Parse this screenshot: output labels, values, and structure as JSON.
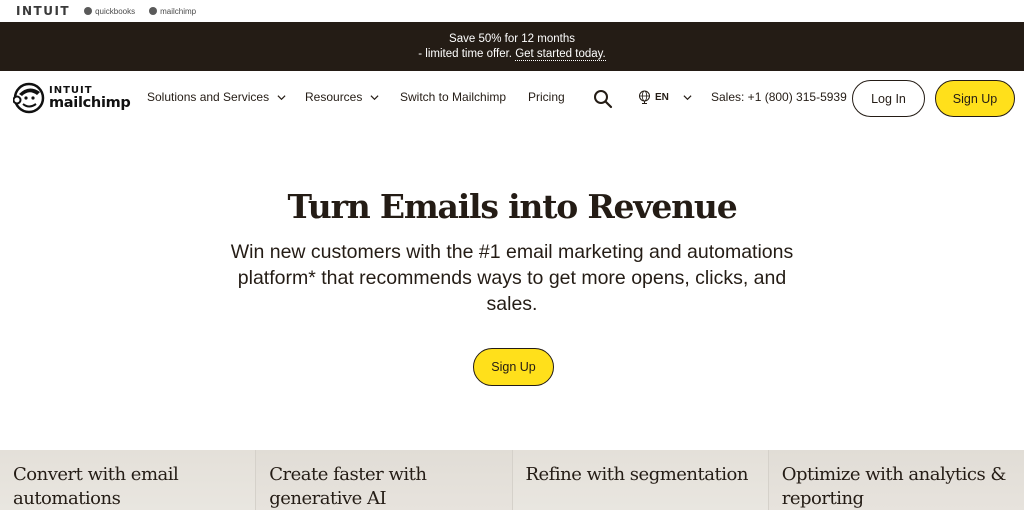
{
  "brandbar": {
    "intuit": "INTUIT",
    "links": [
      {
        "icon": "quickbooks-icon",
        "label": "quickbooks"
      },
      {
        "icon": "mailchimp-icon",
        "label": "mailchimp"
      }
    ]
  },
  "promo": {
    "line1": "Save 50% for 12 months",
    "line2_prefix": "- limited time offer. ",
    "link": "Get started today."
  },
  "nav": {
    "logo": {
      "top": "INTUIT",
      "bottom": "mailchimp",
      "icon": "freddie-chimp-icon"
    },
    "items": [
      {
        "label": "Solutions and Services",
        "dropdown": true
      },
      {
        "label": "Resources",
        "dropdown": true
      },
      {
        "label": "Switch to Mailchimp",
        "dropdown": false
      },
      {
        "label": "Pricing",
        "dropdown": false
      }
    ],
    "search_icon": "search-icon",
    "language": {
      "icon": "globe-icon",
      "value": "EN"
    },
    "sales": "Sales: +1 (800) 315-5939",
    "login": "Log In",
    "signup": "Sign Up"
  },
  "hero": {
    "title": "Turn Emails into Revenue",
    "subtitle": "Win new customers with the #1 email marketing and automations platform* that recommends ways to get more opens, clicks, and sales.",
    "cta": "Sign Up"
  },
  "features": [
    "Convert with email automations",
    "Create faster with generative AI",
    "Refine with segmentation",
    "Optimize with analytics & reporting"
  ],
  "colors": {
    "brand_yellow": "#ffe01b",
    "banner_dark": "#241c15",
    "tile_beige": "#e6e2dc"
  }
}
